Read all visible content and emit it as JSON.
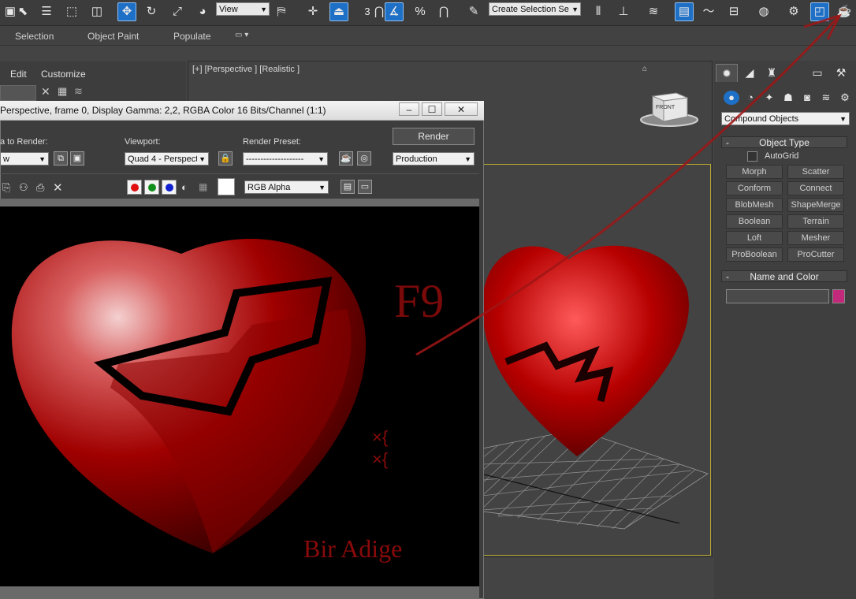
{
  "toolbar": {
    "reference_coord": "View",
    "selection_set_placeholder": "Create Selection Se",
    "snap_value": "3"
  },
  "ribbon": {
    "tabs": [
      "Selection",
      "Object Paint",
      "Populate"
    ]
  },
  "menu": {
    "items": [
      "Edit",
      "Customize"
    ]
  },
  "viewport": {
    "label": "[+] [Perspective ] [Realistic ]",
    "viewcube_label": "FRONT"
  },
  "render_window": {
    "title": "Perspective, frame 0, Display Gamma: 2,2, RGBA Color 16 Bits/Channel (1:1)",
    "area_label": "a to Render:",
    "area_value": "w",
    "viewport_label": "Viewport:",
    "viewport_value": "Quad 4 - Perspect",
    "preset_label": "Render Preset:",
    "preset_value": "--------------------",
    "render_button": "Render",
    "mode_value": "Production",
    "channel_value": "RGB Alpha"
  },
  "annotations": {
    "key_text": "F9",
    "signature": "Bir Adige"
  },
  "command_panel": {
    "category": "Compound Objects",
    "object_type_title": "Object Type",
    "autogrid_label": "AutoGrid",
    "buttons": [
      "Morph",
      "Scatter",
      "Conform",
      "Connect",
      "BlobMesh",
      "ShapeMerge",
      "Boolean",
      "Terrain",
      "Loft",
      "Mesher",
      "ProBoolean",
      "ProCutter"
    ],
    "name_color_title": "Name and Color",
    "object_name": "",
    "swatch_color": "#c2297a"
  },
  "colors": {
    "accent": "#1e6fc6",
    "heart": "#b50000",
    "safe_frame": "#b8a830"
  }
}
